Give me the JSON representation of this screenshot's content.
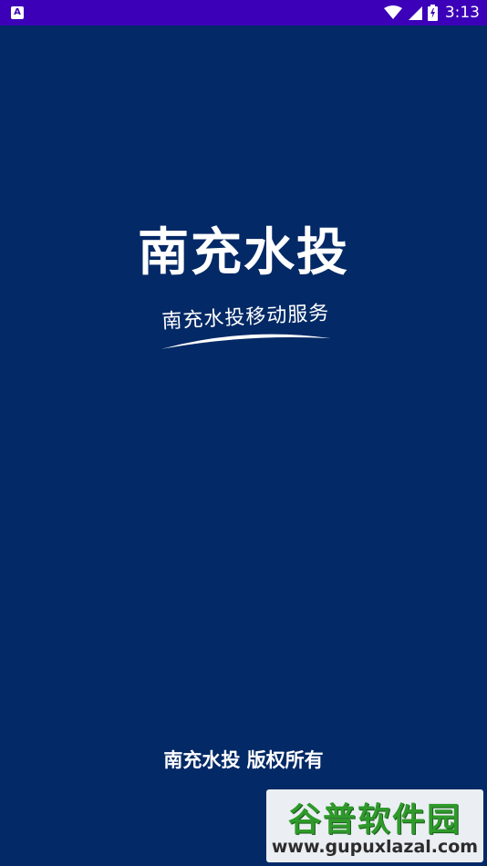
{
  "status_bar": {
    "notification_icon": "A",
    "time": "3:13",
    "icons": [
      "wifi-icon",
      "signal-icon",
      "battery-icon"
    ]
  },
  "splash": {
    "title": "南充水投",
    "tagline": "南充水投移动服务",
    "copyright": "南充水投 版权所有"
  },
  "watermark": {
    "title": "谷普软件园",
    "url": "www.gupuxlazal.com"
  },
  "colors": {
    "background": "#032966",
    "status_bar": "#3b00b8",
    "text": "#ffffff",
    "watermark_green": "#2e9a2a"
  }
}
